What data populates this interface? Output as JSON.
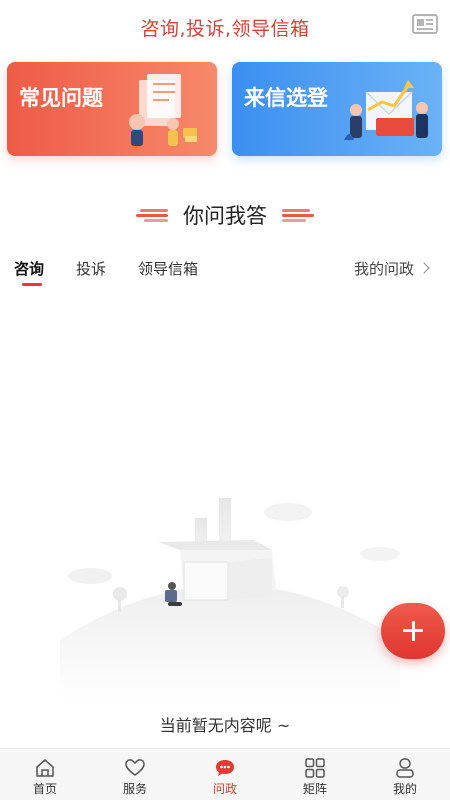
{
  "header": {
    "title": "咨询,投诉,领导信箱",
    "icon": "news-icon"
  },
  "cards": [
    {
      "label": "常见问题",
      "icon": "faq-illustration",
      "color": "#ee5b47"
    },
    {
      "label": "来信选登",
      "icon": "letter-illustration",
      "color": "#3b8ff0"
    }
  ],
  "section": {
    "title": "你问我答"
  },
  "tabs": [
    {
      "label": "咨询",
      "active": true
    },
    {
      "label": "投诉",
      "active": false
    },
    {
      "label": "领导信箱",
      "active": false
    }
  ],
  "my_link": "我的问政",
  "empty": {
    "text": "当前暂无内容呢 ~"
  },
  "fab": {
    "icon": "plus-icon"
  },
  "tabbar": [
    {
      "label": "首页",
      "icon": "home-icon"
    },
    {
      "label": "服务",
      "icon": "heart-icon"
    },
    {
      "label": "问政",
      "icon": "chat-icon",
      "active": true
    },
    {
      "label": "矩阵",
      "icon": "grid-icon"
    },
    {
      "label": "我的",
      "icon": "user-icon"
    }
  ],
  "colors": {
    "accent": "#e03c34",
    "blue": "#3b8ff0"
  }
}
